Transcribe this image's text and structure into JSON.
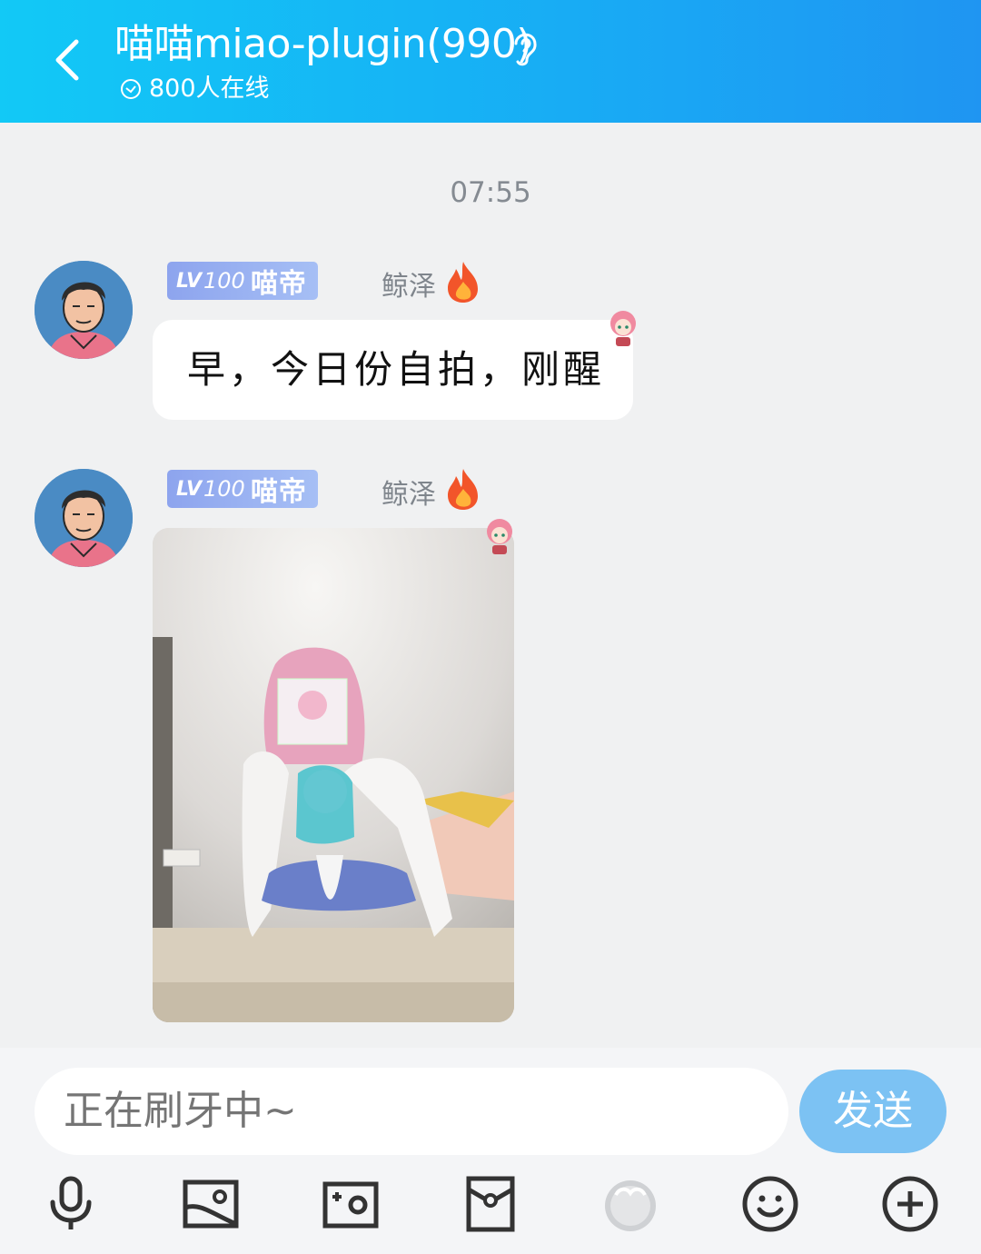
{
  "header": {
    "title": "喵喵miao-plugin(990)",
    "online": "800人在线"
  },
  "chat": {
    "timestamp": "07:55",
    "messages": [
      {
        "badge_lv": "LV",
        "badge_num": "100",
        "badge_name": "喵帝",
        "nickname": "鲸泽",
        "text": "早，今日份自拍，刚醒"
      },
      {
        "badge_lv": "LV",
        "badge_num": "100",
        "badge_name": "喵帝",
        "nickname": "鲸泽",
        "type": "image"
      }
    ]
  },
  "composer": {
    "placeholder": "正在刷牙中~",
    "send_label": "发送"
  },
  "colors": {
    "header_start": "#12c9f6",
    "header_end": "#1f95f2",
    "badge": "#8da4ee",
    "send_button": "#7cc2f3"
  },
  "icons": [
    "back-icon",
    "ear-icon",
    "check-circle-icon",
    "fire-icon",
    "voice-icon",
    "image-icon",
    "camera-icon",
    "red-packet-icon",
    "pokemon-icon",
    "emoji-icon",
    "plus-icon"
  ]
}
